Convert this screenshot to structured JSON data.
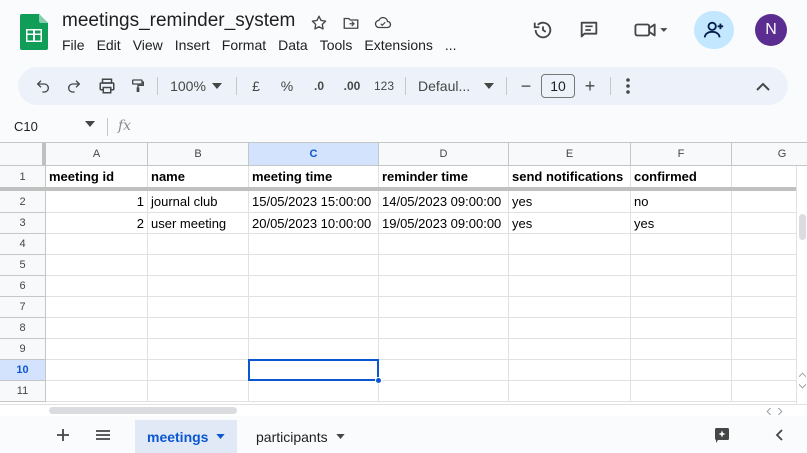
{
  "doc": {
    "title": "meetings_reminder_system",
    "avatar_letter": "N"
  },
  "menu": [
    "File",
    "Edit",
    "View",
    "Insert",
    "Format",
    "Data",
    "Tools",
    "Extensions",
    "..."
  ],
  "toolbar": {
    "zoom": "100%",
    "currency": "£",
    "percent": "%",
    "dec_decrease": ".0",
    "dec_increase": ".00",
    "number_format": "123",
    "font": "Defaul...",
    "font_size": "10",
    "minus": "−",
    "plus": "+"
  },
  "formula_bar": {
    "name_box": "C10",
    "fx": "fx"
  },
  "grid": {
    "columns": [
      "A",
      "B",
      "C",
      "D",
      "E",
      "F",
      "G"
    ],
    "rows": [
      "1",
      "2",
      "3",
      "4",
      "5",
      "6",
      "7",
      "8",
      "9",
      "10",
      "11"
    ],
    "active_column": "C",
    "active_row": "10",
    "header_row": [
      "meeting id",
      "name",
      "meeting time",
      "reminder time",
      "send notifications",
      "confirmed"
    ],
    "data_rows": [
      [
        "1",
        "journal club",
        "15/05/2023 15:00:00",
        "14/05/2023 09:00:00",
        "yes",
        "no"
      ],
      [
        "2",
        "user meeting",
        "20/05/2023 10:00:00",
        "19/05/2023 09:00:00",
        "yes",
        "yes"
      ]
    ]
  },
  "sheets": {
    "tabs": [
      {
        "label": "meetings",
        "active": true
      },
      {
        "label": "participants",
        "active": false
      }
    ]
  },
  "colors": {
    "accent": "#0b57d0",
    "logo_green": "#0f9d58",
    "share_bg": "#c2e7ff",
    "avatar_bg": "#5b2d90"
  }
}
